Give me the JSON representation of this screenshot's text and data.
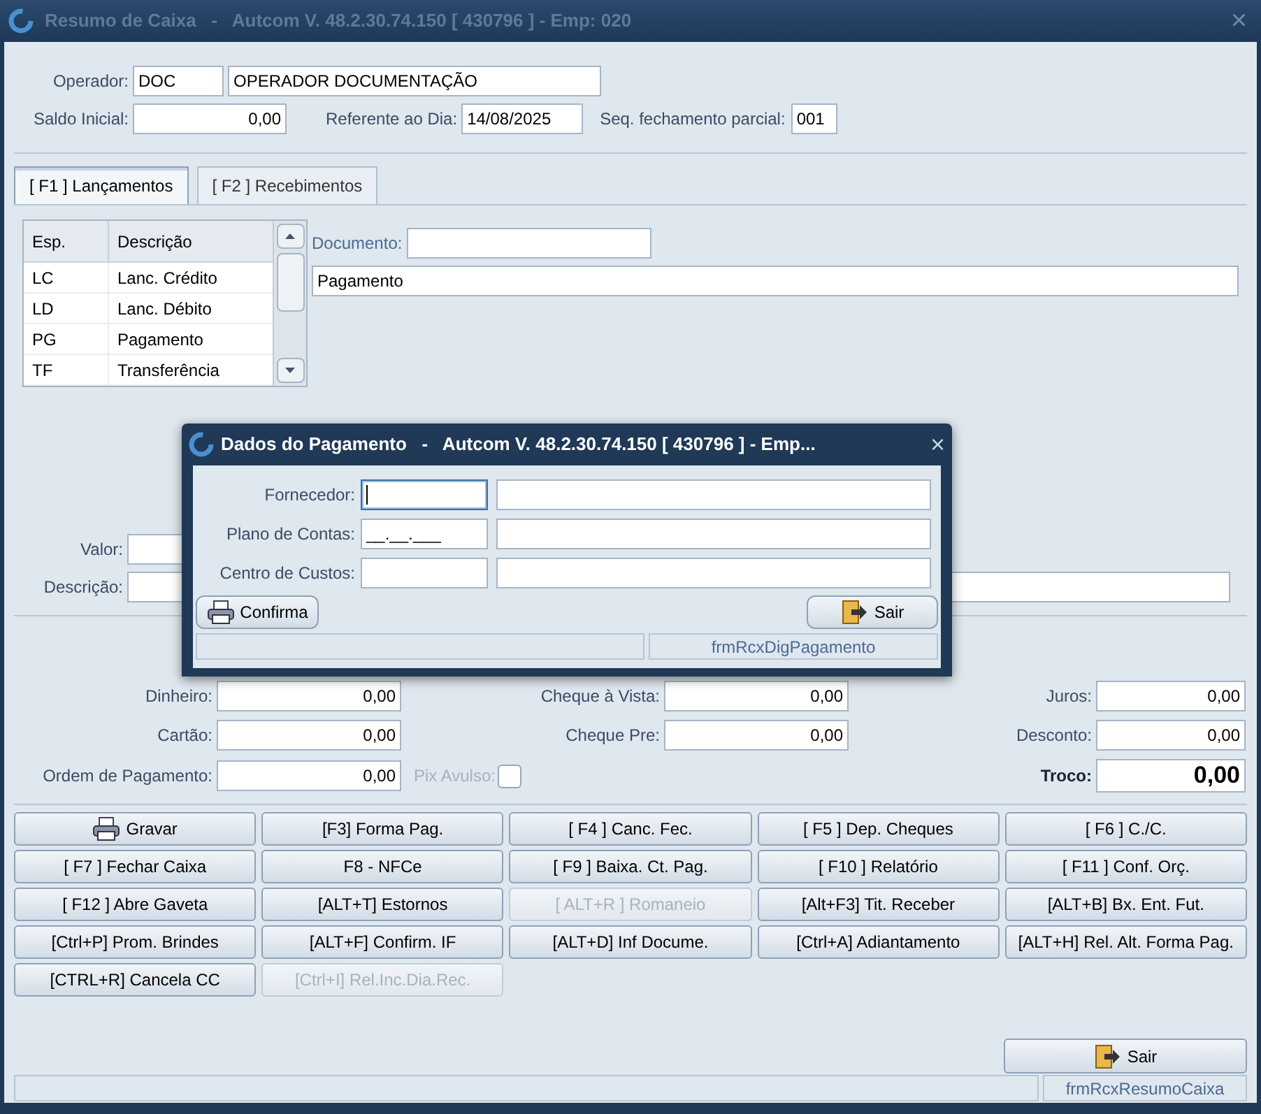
{
  "window": {
    "title": "Resumo de Caixa   -   Autcom V. 48.2.30.74.150 [ 430796 ] - Emp: 020",
    "close": "×"
  },
  "header": {
    "operador": {
      "label": "Operador:",
      "code": "DOC",
      "name": "OPERADOR DOCUMENTAÇÃO"
    },
    "saldo_inicial": {
      "label": "Saldo Inicial:",
      "value": "0,00"
    },
    "referente": {
      "label": "Referente ao Dia:",
      "value": "14/08/2025"
    },
    "seq": {
      "label": "Seq. fechamento parcial:",
      "value": "001"
    }
  },
  "tabs": [
    {
      "label": "[ F1 ] Lançamentos",
      "selected": true
    },
    {
      "label": "[ F2 ] Recebimentos",
      "selected": false
    }
  ],
  "grid": {
    "columns": [
      "Esp.",
      "Descrição"
    ],
    "rows": [
      {
        "esp": "LC",
        "descricao": "Lanc. Crédito"
      },
      {
        "esp": "LD",
        "descricao": "Lanc. Débito"
      },
      {
        "esp": "PG",
        "descricao": "Pagamento"
      },
      {
        "esp": "TF",
        "descricao": "Transferência"
      }
    ]
  },
  "documento": {
    "label": "Documento:"
  },
  "historico": {
    "value": "Pagamento"
  },
  "valor": {
    "label": "Valor:"
  },
  "descricao": {
    "label": "Descrição:"
  },
  "totals": [
    [
      {
        "label": "Dinheiro:",
        "value": "0,00",
        "kind": "field"
      },
      {
        "label": "Cheque à Vista:",
        "value": "0,00",
        "kind": "field"
      },
      {
        "label": "Juros:",
        "value": "0,00",
        "kind": "field"
      }
    ],
    [
      {
        "label": "Cartão:",
        "value": "0,00",
        "kind": "field"
      },
      {
        "label": "Cheque Pre:",
        "value": "0,00",
        "kind": "field"
      },
      {
        "label": "Desconto:",
        "value": "0,00",
        "kind": "field"
      }
    ],
    [
      {
        "label": "Ordem de Pagamento:",
        "value": "0,00",
        "kind": "field"
      },
      {
        "label": "Pix Avulso:",
        "checked": false,
        "disabled": true,
        "kind": "checkbox"
      },
      {
        "label": "Troco:",
        "value": "0,00",
        "kind": "total"
      }
    ]
  ],
  "buttons": [
    {
      "label": "Gravar",
      "disabled": false,
      "icon": true
    },
    {
      "label": "[F3] Forma Pag.",
      "disabled": false,
      "icon": false
    },
    {
      "label": "[ F4 ] Canc. Fec.",
      "disabled": false,
      "icon": false
    },
    {
      "label": "[ F5 ] Dep. Cheques",
      "disabled": false,
      "icon": false
    },
    {
      "label": "[ F6 ] C./C.",
      "disabled": false,
      "icon": false
    },
    {
      "label": "[ F7 ] Fechar Caixa",
      "disabled": false,
      "icon": false
    },
    {
      "label": "F8 - NFCe",
      "disabled": false,
      "icon": false
    },
    {
      "label": "[ F9 ] Baixa. Ct. Pag.",
      "disabled": false,
      "icon": false
    },
    {
      "label": "[ F10 ] Relatório",
      "disabled": false,
      "icon": false
    },
    {
      "label": "[ F11 ] Conf. Orç.",
      "disabled": false,
      "icon": false
    },
    {
      "label": "[ F12 ] Abre Gaveta",
      "disabled": false,
      "icon": false
    },
    {
      "label": "[ALT+T] Estornos",
      "disabled": false,
      "icon": false
    },
    {
      "label": "[ ALT+R ] Romaneio",
      "disabled": true,
      "icon": false
    },
    {
      "label": "[Alt+F3] Tit. Receber",
      "disabled": false,
      "icon": false
    },
    {
      "label": "[ALT+B] Bx. Ent. Fut.",
      "disabled": false,
      "icon": false
    },
    {
      "label": "[Ctrl+P] Prom. Brindes",
      "disabled": false,
      "icon": false
    },
    {
      "label": "[ALT+F] Confirm. IF",
      "disabled": false,
      "icon": false
    },
    {
      "label": "[ALT+D] Inf Docume.",
      "disabled": false,
      "icon": false
    },
    {
      "label": "[Ctrl+A] Adiantamento",
      "disabled": false,
      "icon": false
    },
    {
      "label": "[ALT+H] Rel. Alt. Forma Pag.",
      "disabled": false,
      "icon": false
    },
    {
      "label": "[CTRL+R] Cancela CC",
      "disabled": false,
      "icon": false
    },
    {
      "label": "[Ctrl+I] Rel.Inc.Dia.Rec.",
      "disabled": true,
      "icon": false
    }
  ],
  "exit_button": {
    "label": "Sair"
  },
  "status_bar": {
    "form": "frmRcxResumoCaixa"
  },
  "dialog": {
    "title": "Dados do Pagamento   -   Autcom V. 48.2.30.74.150 [ 430796 ] - Emp...",
    "close": "×",
    "fields": [
      {
        "label": "Fornecedor:",
        "focused": true
      },
      {
        "label": "Plano de Contas:",
        "mask": "__.__.___",
        "focused": false
      },
      {
        "label": "Centro de Custos:",
        "focused": false
      }
    ],
    "confirm_button": {
      "label": "Confirma"
    },
    "exit_button": {
      "label": "Sair"
    },
    "status_bar": {
      "form": "frmRcxDigPagamento"
    }
  }
}
